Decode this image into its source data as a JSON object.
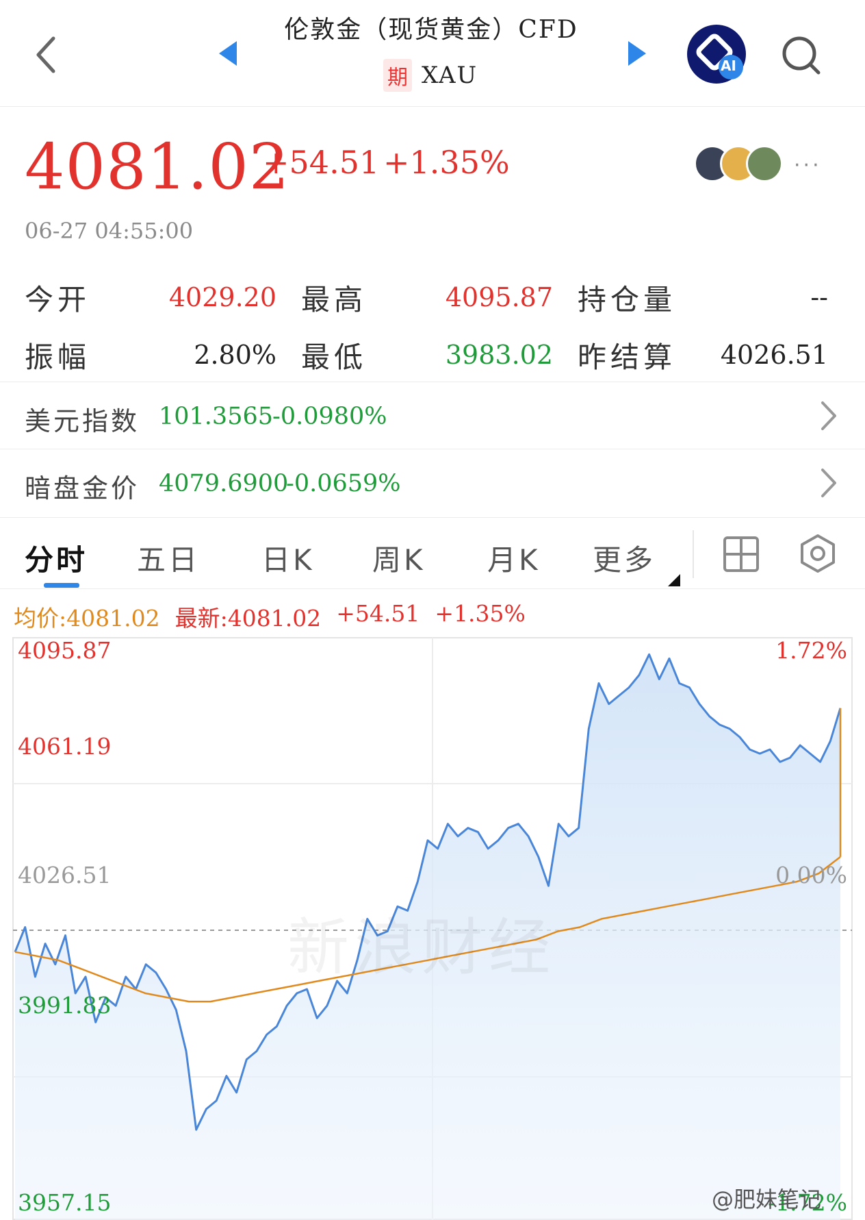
{
  "header": {
    "title": "伦敦金（现货黄金）CFD",
    "tag": "期",
    "code": "XAU",
    "ai_badge": "AI",
    "icons": [
      "back-arrow-icon",
      "prev-triangle-icon",
      "next-triangle-icon",
      "ai-assistant-icon",
      "search-icon"
    ]
  },
  "quote": {
    "price": "4081.02",
    "change": "+54.51",
    "change_pct": "+1.35%",
    "time": "06-27 04:55:00",
    "more": "···"
  },
  "stats": {
    "open_label": "今开",
    "open": "4029.20",
    "high_label": "最高",
    "high": "4095.87",
    "oi_label": "持仓量",
    "oi": "--",
    "amp_label": "振幅",
    "amp": "2.80%",
    "low_label": "最低",
    "low": "3983.02",
    "settle_label": "昨结算",
    "settle": "4026.51"
  },
  "related": [
    {
      "label": "美元指数",
      "value": "101.3565",
      "change": "-0.0980%"
    },
    {
      "label": "暗盘金价",
      "value": "4079.6900",
      "change": "-0.0659%"
    }
  ],
  "tabs": [
    "分时",
    "五日",
    "日K",
    "周K",
    "月K",
    "更多"
  ],
  "summary": {
    "avg_label": "均价:",
    "avg": "4081.02",
    "latest_label": "最新:",
    "latest": "4081.02",
    "change": "+54.51",
    "change_pct": "+1.35%"
  },
  "watermark": "新浪财经",
  "weibo": "@肥妹笔记",
  "colors": {
    "up": "#e2322e",
    "down": "#1f9b3a",
    "line": "#4a86d8",
    "avg_line": "#e08a1e",
    "accent": "#2d86e8"
  },
  "chart_data": {
    "type": "line",
    "ylim": [
      3957.15,
      4095.87
    ],
    "y_ticks_left": [
      "4095.87",
      "4061.19",
      "4026.51",
      "3991.83",
      "3957.15"
    ],
    "y_ticks_right": [
      "1.72%",
      "0.00%",
      "-1.72%"
    ],
    "baseline": 4026.51,
    "series": [
      {
        "values": [
          4022,
          4028,
          4016,
          4024,
          4019,
          4026,
          4012,
          4016,
          4005,
          4011,
          4009,
          4016,
          4013,
          4019,
          4017,
          4013,
          4008,
          3998,
          3979,
          3984,
          3986,
          3992,
          3988,
          3996,
          3998,
          4002,
          4004,
          4009,
          4012,
          4013,
          4006,
          4009,
          4015,
          4012,
          4020,
          4030,
          4026,
          4027,
          4033,
          4032,
          4039,
          4049,
          4047,
          4053,
          4050,
          4052,
          4051,
          4047,
          4049,
          4052,
          4053,
          4050,
          4045,
          4038,
          4053,
          4050,
          4052,
          4076,
          4087,
          4082,
          4084,
          4086,
          4089,
          4094,
          4088,
          4093,
          4087,
          4086,
          4082,
          4079,
          4077,
          4076,
          4074,
          4071,
          4070,
          4071,
          4068,
          4069,
          4072,
          4070,
          4068,
          4073,
          4081
        ]
      },
      {
        "values": [
          4022,
          4021,
          4020,
          4018,
          4016,
          4014,
          4012,
          4011,
          4010,
          4010,
          4011,
          4012,
          4013,
          4014,
          4015,
          4016,
          4017,
          4018,
          4019,
          4020,
          4021,
          4022,
          4023,
          4024,
          4025,
          4027,
          4028,
          4030,
          4031,
          4032,
          4033,
          4034,
          4035,
          4036,
          4037,
          4038,
          4039,
          4041,
          4045
        ]
      }
    ]
  }
}
